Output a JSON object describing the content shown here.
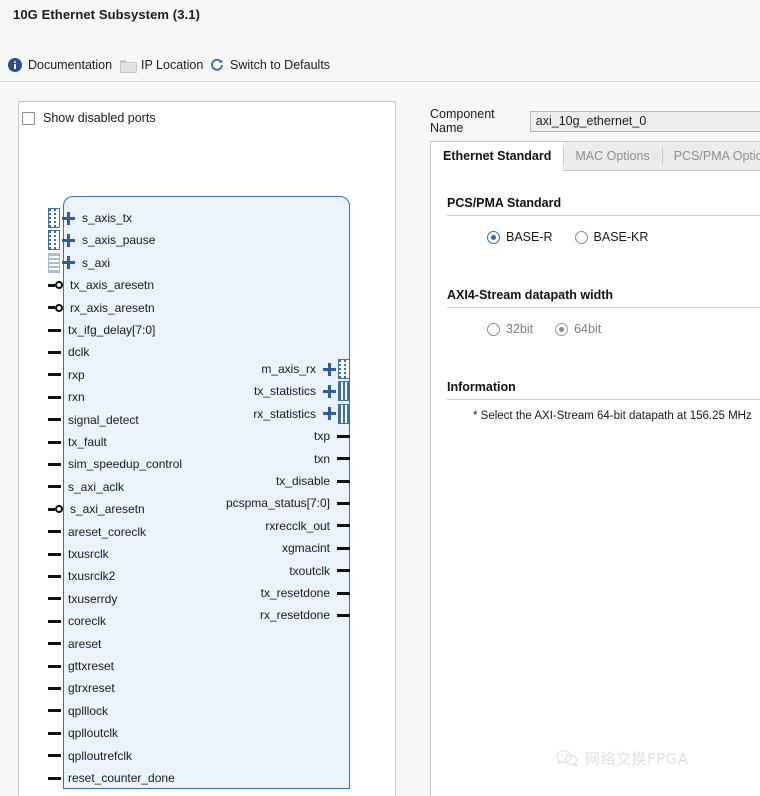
{
  "window": {
    "title": "10G Ethernet Subsystem (3.1)"
  },
  "toolbar": {
    "documentation": "Documentation",
    "ip_location": "IP Location",
    "switch_defaults": "Switch to Defaults",
    "icons": {
      "documentation": "info-icon",
      "ip_location": "folder-icon",
      "switch_defaults": "refresh-icon"
    }
  },
  "diagram": {
    "show_disabled_ports": "Show disabled ports",
    "show_disabled_checked": false,
    "left_ports": [
      {
        "name": "s_axis_tx",
        "marker": "bus",
        "pad": "dotted"
      },
      {
        "name": "s_axis_pause",
        "marker": "bus",
        "pad": "dotted"
      },
      {
        "name": "s_axi",
        "marker": "bus",
        "pad": "faint"
      },
      {
        "name": "tx_axis_aresetn",
        "marker": "bubble"
      },
      {
        "name": "rx_axis_aresetn",
        "marker": "bubble"
      },
      {
        "name": "tx_ifg_delay[7:0]",
        "marker": "stub"
      },
      {
        "name": "dclk",
        "marker": "stub"
      },
      {
        "name": "rxp",
        "marker": "stub"
      },
      {
        "name": "rxn",
        "marker": "stub"
      },
      {
        "name": "signal_detect",
        "marker": "stub"
      },
      {
        "name": "tx_fault",
        "marker": "stub"
      },
      {
        "name": "sim_speedup_control",
        "marker": "stub"
      },
      {
        "name": "s_axi_aclk",
        "marker": "stub"
      },
      {
        "name": "s_axi_aresetn",
        "marker": "bubble"
      },
      {
        "name": "areset_coreclk",
        "marker": "stub"
      },
      {
        "name": "txusrclk",
        "marker": "stub"
      },
      {
        "name": "txusrclk2",
        "marker": "stub"
      },
      {
        "name": "txuserrdy",
        "marker": "stub"
      },
      {
        "name": "coreclk",
        "marker": "stub"
      },
      {
        "name": "areset",
        "marker": "stub"
      },
      {
        "name": "gttxreset",
        "marker": "stub"
      },
      {
        "name": "gtrxreset",
        "marker": "stub"
      },
      {
        "name": "qplllock",
        "marker": "stub"
      },
      {
        "name": "qplloutclk",
        "marker": "stub"
      },
      {
        "name": "qplloutrefclk",
        "marker": "stub"
      },
      {
        "name": "reset_counter_done",
        "marker": "stub"
      }
    ],
    "right_ports": [
      {
        "name": "m_axis_rx",
        "marker": "bus",
        "pad": "dotted"
      },
      {
        "name": "tx_statistics",
        "marker": "bus",
        "pad": "vstripe"
      },
      {
        "name": "rx_statistics",
        "marker": "bus",
        "pad": "vstripe"
      },
      {
        "name": "txp",
        "marker": "stub"
      },
      {
        "name": "txn",
        "marker": "stub"
      },
      {
        "name": "tx_disable",
        "marker": "stub"
      },
      {
        "name": "pcspma_status[7:0]",
        "marker": "stub"
      },
      {
        "name": "rxrecclk_out",
        "marker": "stub"
      },
      {
        "name": "xgmacint",
        "marker": "stub"
      },
      {
        "name": "txoutclk",
        "marker": "stub"
      },
      {
        "name": "tx_resetdone",
        "marker": "stub"
      },
      {
        "name": "rx_resetdone",
        "marker": "stub"
      }
    ]
  },
  "config": {
    "component_name_label": "Component Name",
    "component_name_value": "axi_10g_ethernet_0",
    "tabs": [
      {
        "label": "Ethernet Standard",
        "active": true
      },
      {
        "label": "MAC Options",
        "active": false
      },
      {
        "label": "PCS/PMA Options",
        "active": false
      }
    ],
    "pcs_pma_standard": {
      "title": "PCS/PMA Standard",
      "options": [
        {
          "label": "BASE-R",
          "checked": true,
          "disabled": false
        },
        {
          "label": "BASE-KR",
          "checked": false,
          "disabled": false
        }
      ]
    },
    "datapath_width": {
      "title": "AXI4-Stream datapath width",
      "options": [
        {
          "label": "32bit",
          "checked": false,
          "disabled": true
        },
        {
          "label": "64bit",
          "checked": true,
          "disabled": true
        }
      ]
    },
    "information": {
      "title": "Information",
      "text": "* Select the AXI-Stream 64-bit datapath at 156.25 MHz"
    }
  },
  "watermark": {
    "text": "网络交换FPGA",
    "logo": "wechat-logo-icon"
  },
  "colors": {
    "accent_blue": "#2c6fb5",
    "block_border": "#3a6ea5",
    "block_fill": "#ecf2fc",
    "bus_blue": "#2f5c9e",
    "panel_bg": "#f7f7f7"
  }
}
